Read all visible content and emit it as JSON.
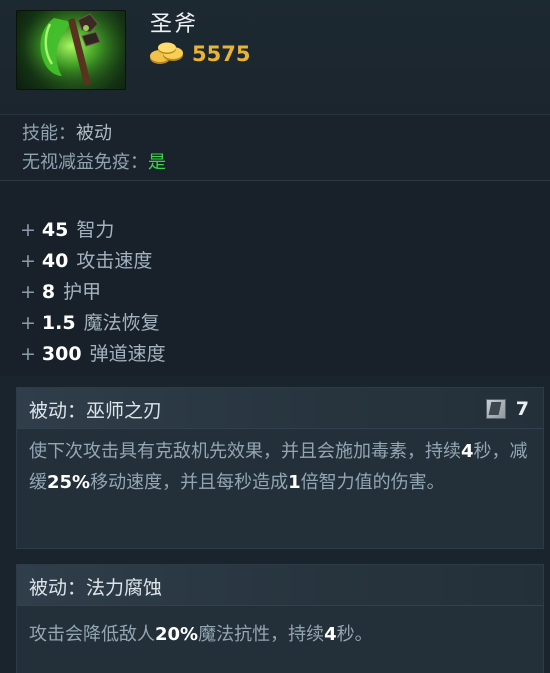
{
  "item": {
    "name": "圣斧",
    "icon": "holy-axe-icon",
    "cost": "5575",
    "cost_icon": "gold-coins-icon",
    "accent": "#e8b434"
  },
  "meta": {
    "skill_label": "技能：",
    "skill_value": "被动",
    "immunity_label": "无视减益免疫：",
    "immunity_value": "是",
    "immunity_color": "#3cd54a"
  },
  "attributes": [
    {
      "plus": "+",
      "value": "45",
      "name": "智力"
    },
    {
      "plus": "+",
      "value": "40",
      "name": "攻击速度"
    },
    {
      "plus": "+",
      "value": "8",
      "name": "护甲"
    },
    {
      "plus": "+",
      "value": "1.5",
      "name": "魔法恢复"
    },
    {
      "plus": "+",
      "value": "300",
      "name": "弹道速度"
    }
  ],
  "abilities": [
    {
      "title": "被动：巫师之刃",
      "cooldown_icon": "cooldown-icon",
      "cooldown": "7",
      "description": {
        "p1": "使下次攻击具有克敌机先效果，并且会施加毒素，持续",
        "n1": "4",
        "p2": "秒，减缓",
        "n2": "25%",
        "p3": "移动速度，并且每秒造成",
        "n3": "1",
        "p4": "倍智力值的伤害。"
      }
    },
    {
      "title": "被动：法力腐蚀",
      "description": {
        "p1": "攻击会降低敌人",
        "n1": "20%",
        "p2": "魔法抗性，持续",
        "n2": "4",
        "p3": "秒。"
      }
    }
  ]
}
